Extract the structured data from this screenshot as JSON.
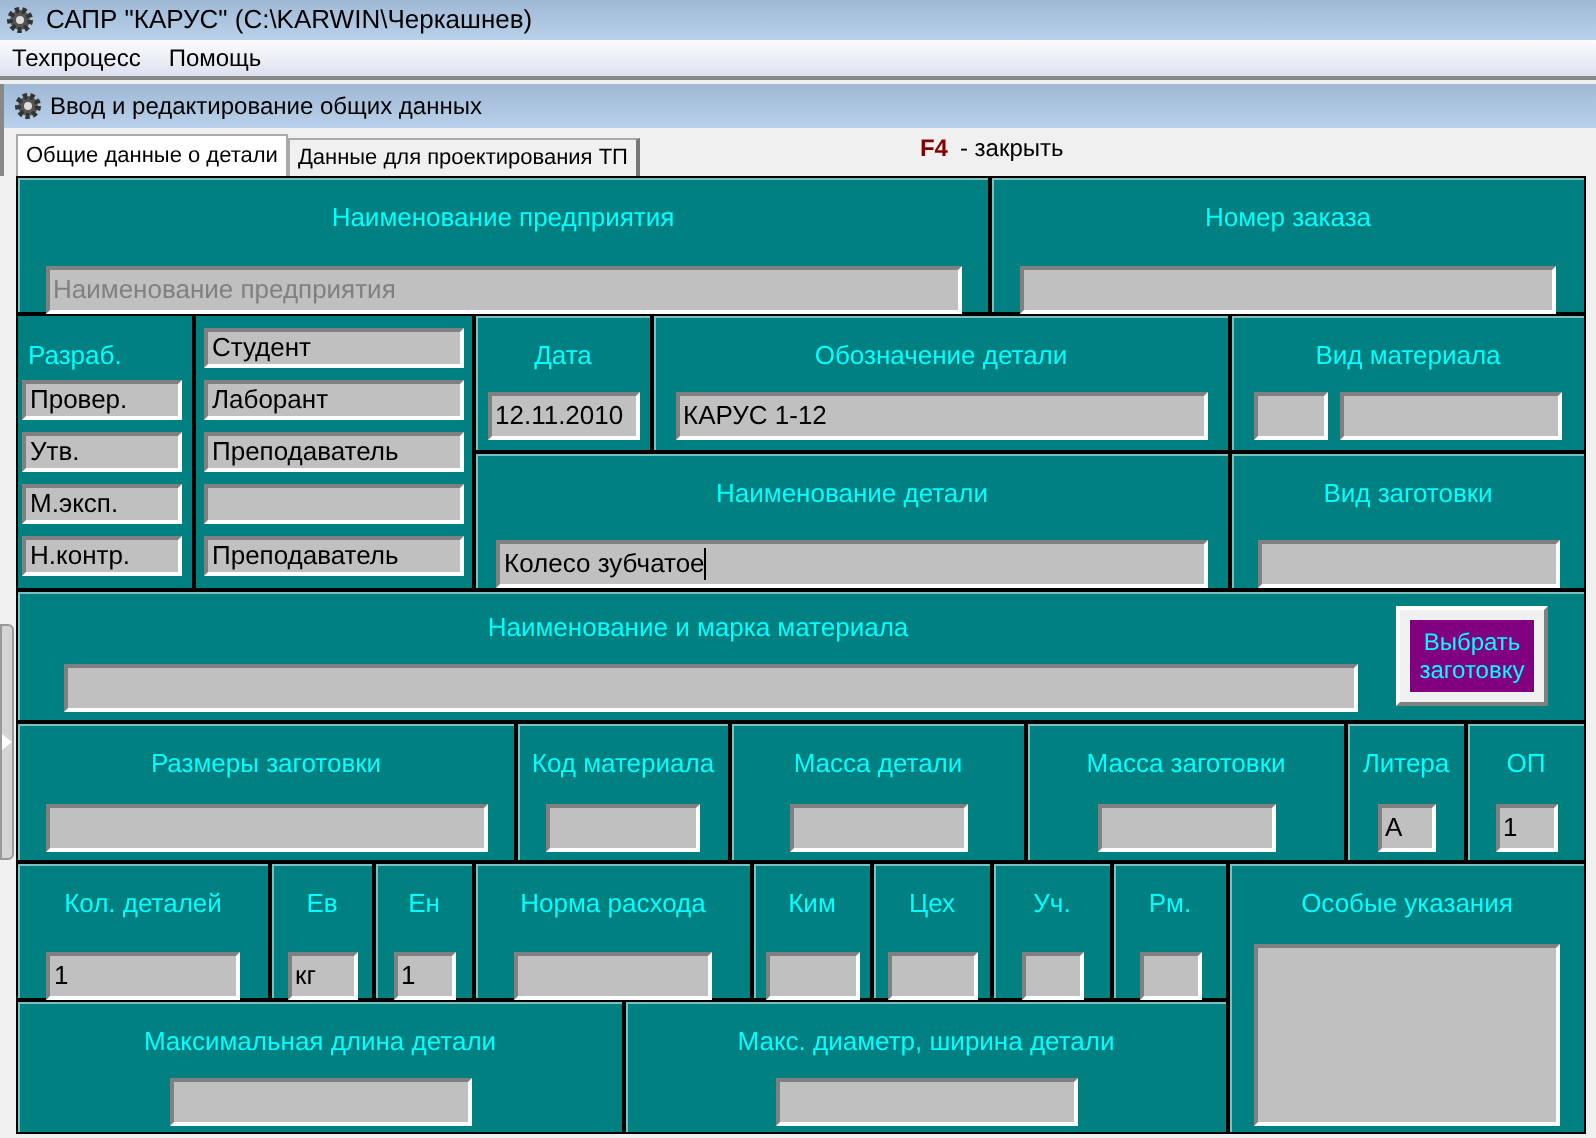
{
  "window": {
    "title": "САПР \"КАРУС\" (C:\\KARWIN\\Черкашнев)"
  },
  "menu": [
    "Техпроцесс",
    "Помощь"
  ],
  "dialog": {
    "title": "Ввод и редактирование общих данных"
  },
  "tabs": [
    {
      "label": "Общие данные о детали",
      "selected": true
    },
    {
      "label": "Данные для проектирования ТП",
      "selected": false
    }
  ],
  "hotkey": {
    "key": "F4",
    "action": "- закрыть"
  },
  "form": {
    "enterprise": {
      "label": "Наименование предприятия",
      "placeholder": "Наименование предприятия"
    },
    "order_number": {
      "label": "Номер заказа"
    },
    "signatures": [
      {
        "kind": "label",
        "role": "Разраб.",
        "name": "Студент"
      },
      {
        "kind": "field",
        "role": "Провер.",
        "name": "Лаборант"
      },
      {
        "kind": "field",
        "role": "Утв.",
        "name": "Преподаватель"
      },
      {
        "kind": "field",
        "role": "М.эксп."
      },
      {
        "kind": "field",
        "role": "Н.контр.",
        "name": "Преподаватель"
      }
    ],
    "date": {
      "label": "Дата",
      "value": "12.11.2010"
    },
    "designation": {
      "label": "Обозначение детали",
      "value": "КАРУС 1-12"
    },
    "material_kind": {
      "label": "Вид материала"
    },
    "part_name": {
      "label": "Наименование детали",
      "value": "Колесо зубчатое",
      "focused": true
    },
    "blank_kind": {
      "label": "Вид заготовки"
    },
    "material": {
      "label": "Наименование и марка материала"
    },
    "choose_blank_button": "Выбрать заготовку",
    "blank_size": {
      "label": "Размеры заготовки"
    },
    "material_code": {
      "label": "Код материала"
    },
    "part_mass": {
      "label": "Масса детали"
    },
    "blank_mass": {
      "label": "Масса заготовки"
    },
    "litera": {
      "label": "Литера",
      "value": "А"
    },
    "op": {
      "label": "ОП",
      "value": "1"
    },
    "part_count": {
      "label": "Кол. деталей",
      "value": "1"
    },
    "ev": {
      "label": "Ев",
      "value": "кг"
    },
    "en": {
      "label": "Ен",
      "value": "1"
    },
    "consumption_rate": {
      "label": "Норма расхода"
    },
    "kim": {
      "label": "Ким"
    },
    "shop": {
      "label": "Цех"
    },
    "section": {
      "label": "Уч."
    },
    "workplace": {
      "label": "Рм."
    },
    "max_length": {
      "label": "Максимальная длина детали"
    },
    "max_diameter": {
      "label": "Макс. диаметр, ширина детали"
    },
    "special_notes": {
      "label": "Особые указания"
    }
  }
}
